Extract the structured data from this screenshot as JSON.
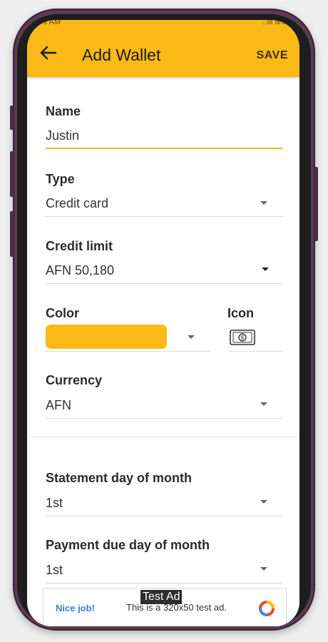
{
  "status_bar": {
    "time": "9 AM",
    "icons": "..ıll 8/s"
  },
  "app_bar": {
    "back_icon": "arrow-back-icon",
    "title": "Add Wallet",
    "save_label": "SAVE"
  },
  "form": {
    "name": {
      "label": "Name",
      "value": "Justin"
    },
    "type": {
      "label": "Type",
      "value": "Credit card"
    },
    "credit_limit": {
      "label": "Credit limit",
      "value": "AFN 50,180"
    },
    "color": {
      "label": "Color",
      "value": "#fbb918"
    },
    "icon": {
      "label": "Icon",
      "value": "banknote-icon"
    },
    "currency": {
      "label": "Currency",
      "value": "AFN"
    },
    "statement_day": {
      "label": "Statement day of month",
      "value": "1st"
    },
    "payment_due_day": {
      "label": "Payment due day of month",
      "value": "1st"
    }
  },
  "ad": {
    "tag": "Test Ad",
    "nice_job": "Nice job!",
    "text": "This is a 320x50 test ad."
  },
  "colors": {
    "accent": "#fbb918",
    "frame": "#5b3a52"
  }
}
